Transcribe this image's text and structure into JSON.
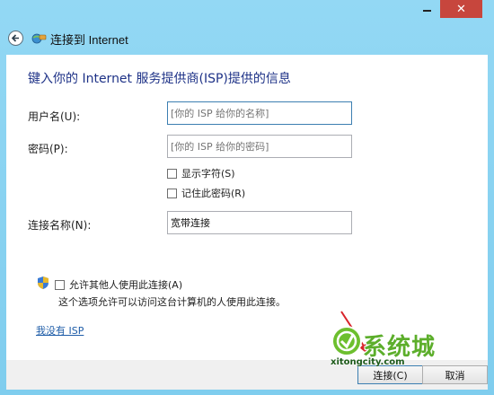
{
  "titlebar": {
    "close_glyph": "✕"
  },
  "window": {
    "title": "连接到 Internet"
  },
  "form": {
    "heading": "键入你的 Internet 服务提供商(ISP)提供的信息",
    "username": {
      "label": "用户名(U):",
      "placeholder": "[你的 ISP 给你的名称]"
    },
    "password": {
      "label": "密码(P):",
      "placeholder": "[你的 ISP 给你的密码]"
    },
    "show_chars": {
      "label": "显示字符(S)",
      "checked": false
    },
    "remember_password": {
      "label": "记住此密码(R)",
      "checked": false
    },
    "connection_name": {
      "label": "连接名称(N):",
      "value": "宽带连接"
    },
    "allow_others": {
      "label": "允许其他人使用此连接(A)",
      "checked": false,
      "note": "这个选项允许可以访问这台计算机的人使用此连接。"
    },
    "no_isp_link": "我没有 ISP"
  },
  "buttons": {
    "connect": "连接(C)",
    "cancel": "取消"
  },
  "watermark": {
    "text": "系统城",
    "url": "xitongcity.com"
  },
  "colors": {
    "frame": "#8ad5f3",
    "heading": "#1e3287",
    "link": "#1f5da8",
    "close": "#c7463d"
  }
}
